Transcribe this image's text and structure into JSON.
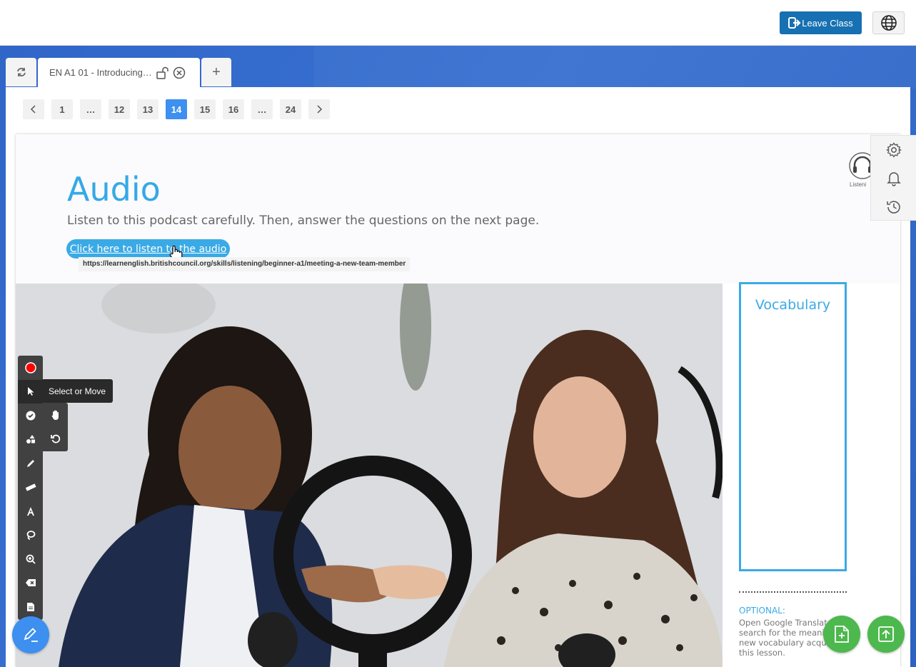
{
  "header": {
    "leave_label": "Leave Class"
  },
  "tabs": {
    "active_title": "EN A1 01 - Introducing…",
    "add_label": "+"
  },
  "pagination": {
    "pages": [
      "1",
      "…",
      "12",
      "13",
      "14",
      "15",
      "16",
      "…",
      "24"
    ],
    "active": "14"
  },
  "slide": {
    "title": "Audio",
    "subtitle": "Listen to this podcast carefully. Then, answer the questions on the next page.",
    "link_label": "Click here to listen to the audio",
    "link_url": "https://learnenglish.britishcouncil.org/skills/listening/beginner-a1/meeting-a-new-team-member",
    "listening_label": "Listeni",
    "vocab_title": "Vocabulary",
    "optional_label": "OPTIONAL:",
    "optional_text": "Open Google Translat search for the meanin new vocabulary acqui this lesson."
  },
  "toolbar": {
    "tooltip": "Select or Move",
    "record_color": "#ff0000"
  },
  "colors": {
    "accent": "#3d8ff0",
    "leave_button": "#1670b2",
    "slide_blue": "#3aaae6",
    "fab_green": "#4db84d"
  }
}
